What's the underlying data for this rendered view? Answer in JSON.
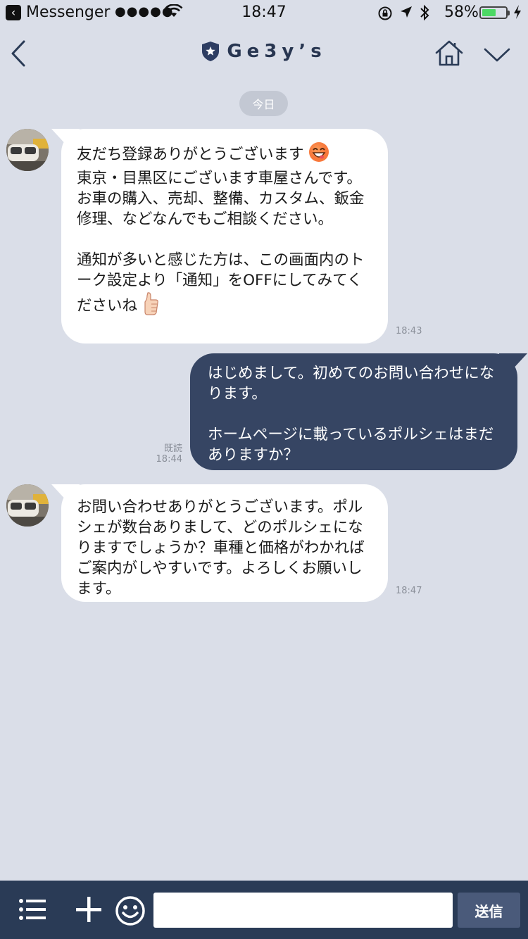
{
  "status_bar": {
    "app_back_label": "Messenger",
    "signal": "●●●●●",
    "time": "18:47",
    "battery_percent": "58%",
    "battery_level": 0.58
  },
  "header": {
    "title": "Ge3y’s"
  },
  "date_separator": "今日",
  "messages": [
    {
      "direction": "incoming",
      "text_line1": "友だち登録ありがとうございます",
      "text_rest": "\n東京・目黒区にございます車屋さんです。\nお車の購入、売却、整備、カスタム、鈑金\n修理、などなんでもご相談ください。\n\n通知が多いと感じた方は、この画面内のト\nーク設定より「通知」をOFFにしてみてく\nださいね",
      "time": "18:43"
    },
    {
      "direction": "outgoing",
      "text": "はじめまして。初めてのお問い合わせにな\nります。\n\nホームページに載っているポルシェはまだ\nありますか？",
      "read_label": "既読",
      "time": "18:44"
    },
    {
      "direction": "incoming",
      "text": "お問い合わせありがとうございます。ポル\nシェが数台ありまして、どのポルシェにな\nりますでしょうか？車種と価格がわかれば\nご案内がしやすいです。よろしくお願いし\nます。",
      "time": "18:47"
    }
  ],
  "input": {
    "value": "",
    "placeholder": ""
  },
  "send_label": "送信",
  "colors": {
    "background": "#dadee8",
    "outgoing_bubble": "#364563",
    "bottom_bar": "#2a3b56",
    "battery": "#4cd964"
  },
  "icons": [
    "back-chevron-icon",
    "shield-star-icon",
    "home-icon",
    "chevron-down-icon",
    "menu-list-icon",
    "plus-icon",
    "smile-icon",
    "grinning-emoji-icon",
    "thumbs-up-emoji-icon",
    "wifi-icon",
    "bluetooth-icon",
    "location-arrow-icon",
    "rotation-lock-icon",
    "charging-bolt-icon"
  ]
}
